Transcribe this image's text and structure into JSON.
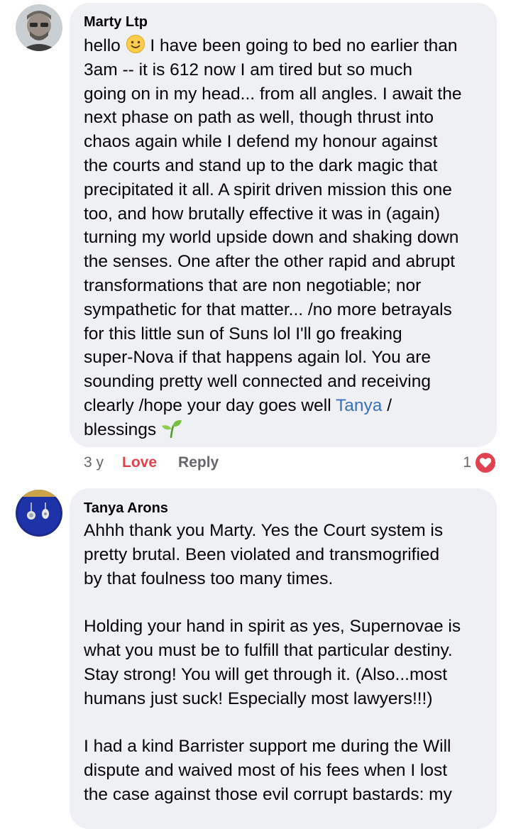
{
  "comments": [
    {
      "author": "Marty Ltp",
      "lines": [
        "I have been going to bed no earlier than",
        "3am -- it is 612 now I am tired but so much",
        "going on in my head... from all angles. I await the",
        "next phase on path as well, though thrust into",
        "chaos again while I defend my honour against",
        "the courts and stand up to the dark magic that",
        "precipitated it all. A spirit driven mission this one",
        "too, and how brutally effective it was in (again)",
        "turning my world upside down and shaking down",
        "the senses. One after the other rapid and abrupt",
        "transformations that are non negotiable; nor",
        "sympathetic for that matter... /no more betrayals",
        "for this little sun of Suns lol I'll go freaking",
        "super-Nova if that happens again lol. You are",
        "sounding pretty well connected and receiving",
        "clearly /hope your day goes well"
      ],
      "first_word": "hello",
      "mention": "Tanya",
      "after_mention": " /",
      "last_line": "blessings",
      "smile_icon": "smiling-face-emoji",
      "seedling_icon": "seedling-emoji",
      "time": "3 y",
      "love_label": "Love",
      "reply_label": "Reply",
      "reaction_count": "1",
      "reaction_color": "#e0424f"
    },
    {
      "author": "Tanya Arons",
      "lines": [
        "Ahhh thank you Marty.  Yes the Court system is",
        "pretty brutal. Been violated and transmogrified",
        "by that foulness too many times.",
        "",
        "Holding your hand in spirit as yes, Supernovae is",
        "what you must be to fulfill that particular destiny.",
        "Stay strong!  You will get through it.  (Also...most",
        "humans just suck! Especially most lawyers!!!)",
        "",
        "I had a kind Barrister support me during the Will",
        "dispute and waived most of his fees when I lost",
        "the case against those evil corrupt bastards: my"
      ]
    }
  ],
  "colors": {
    "bubble": "#eff0f4",
    "mention": "#3b6fbd",
    "love": "#e0424f",
    "meta": "#65676b"
  }
}
